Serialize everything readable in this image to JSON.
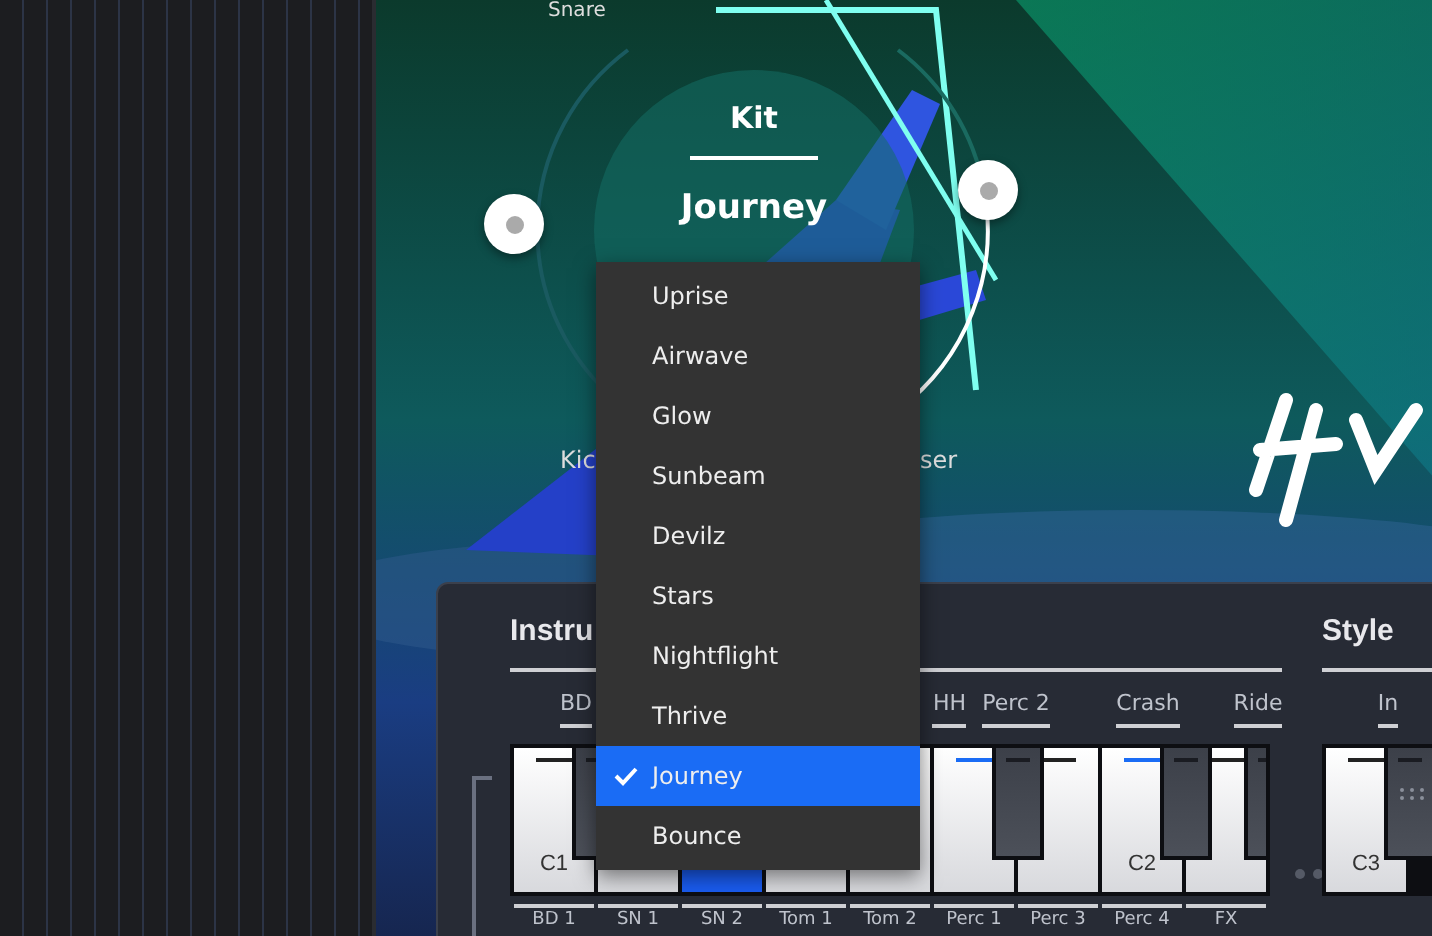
{
  "knob_area": {
    "top_label": "Snare",
    "left_label": "Kic",
    "right_label": "ser"
  },
  "kit": {
    "heading": "Kit",
    "value": "Journey"
  },
  "kit_menu": [
    {
      "label": "Uprise",
      "selected": false
    },
    {
      "label": "Airwave",
      "selected": false
    },
    {
      "label": "Glow",
      "selected": false
    },
    {
      "label": "Sunbeam",
      "selected": false
    },
    {
      "label": "Devilz",
      "selected": false
    },
    {
      "label": "Stars",
      "selected": false
    },
    {
      "label": "Nightflight",
      "selected": false
    },
    {
      "label": "Thrive",
      "selected": false
    },
    {
      "label": "Journey",
      "selected": true
    },
    {
      "label": "Bounce",
      "selected": false
    }
  ],
  "instruments": {
    "heading": "Instru",
    "top_labels": [
      "BD",
      "HH",
      "Perc 2",
      "Crash",
      "Ride"
    ],
    "white_keys": [
      {
        "label": "C1",
        "pressed": false,
        "marked": false
      },
      {
        "pressed": false
      },
      {
        "pressed": true
      },
      {
        "pressed": false
      },
      {
        "pressed": false
      },
      {
        "pressed": false,
        "marked": true
      },
      {
        "pressed": false,
        "marked": false
      },
      {
        "label": "C2",
        "pressed": false,
        "marked": true
      },
      {
        "pressed": false,
        "marked": false
      }
    ],
    "black_keys": [
      {
        "marked": false
      },
      {
        "marked": false
      },
      {
        "marked": false
      },
      {
        "marked": false
      }
    ],
    "bottom_labels": [
      "BD 1",
      "SN 1",
      "SN 2",
      "Tom 1",
      "Tom 2",
      "Perc 1",
      "Perc 3",
      "Perc 4",
      "FX"
    ]
  },
  "style": {
    "heading": "Style",
    "top_labels": [
      "In"
    ],
    "white_keys": [
      {
        "label": "C3",
        "pressed": false,
        "marked": false
      }
    ],
    "black_keys": [
      {
        "marked": false,
        "grip": true
      }
    ]
  }
}
